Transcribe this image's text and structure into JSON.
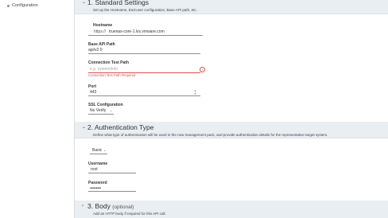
{
  "nav": {
    "items": [
      {
        "label": "Configuration"
      }
    ]
  },
  "sections": {
    "standard": {
      "chevron": "chevron-down",
      "title": "1. Standard Settings",
      "description": "Set up the Hostname, End-user configuration, Base API path, etc."
    },
    "auth": {
      "chevron": "chevron-down",
      "title": "2. Authentication Type",
      "description": "Define what type of authentication will be used in the new management pack, and provide authentication details for the representative target system."
    },
    "body": {
      "chevron": "chevron-right",
      "title": "3. Body",
      "optional": "(optional)",
      "description": "Add an HTTP body if required for this API call."
    }
  },
  "fields": {
    "hostname": {
      "label": "Hostname",
      "protocol": "https://",
      "value": "truenas-core-1.lvs.vmware.com"
    },
    "base_api_path": {
      "label": "Base API Path",
      "value": "api/v2.0"
    },
    "connection_test_path": {
      "label": "Connection Test Path",
      "placeholder": "e.g. system/info",
      "error": "Connection Test Path Required",
      "error_icon": "error-circle-icon"
    },
    "port": {
      "label": "Port",
      "value": "443"
    },
    "ssl": {
      "label": "SSL Configuration",
      "value": "No Verify"
    },
    "auth_type": {
      "value": "Basic"
    },
    "username": {
      "label": "Username",
      "value": "root"
    },
    "password": {
      "label": "Password",
      "value": "•••••••••"
    }
  },
  "colors": {
    "error": "#d6524f",
    "section_header_bg": "#e9eef2"
  }
}
